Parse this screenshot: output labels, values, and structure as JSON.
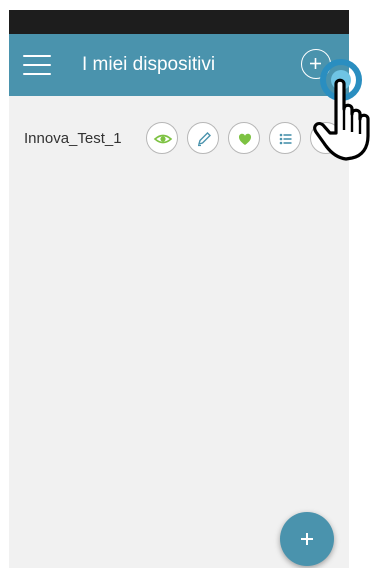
{
  "app_bar": {
    "title": "I miei dispositivi",
    "menu_icon": "hamburger-menu-icon",
    "add_icon": "plus-circle-icon"
  },
  "devices": [
    {
      "name": "Innova_Test_1",
      "actions": [
        {
          "icon": "eye-icon",
          "color": "#7dc242"
        },
        {
          "icon": "pencil-icon",
          "color": "#4a93ad"
        },
        {
          "icon": "heart-icon",
          "color": "#7dc242"
        },
        {
          "icon": "list-icon",
          "color": "#4a93ad"
        },
        {
          "icon": "trash-icon",
          "color": "#8a8a8a"
        }
      ]
    }
  ],
  "fab": {
    "icon": "plus-icon"
  },
  "overlay": {
    "icon": "pointing-hand-icon"
  },
  "colors": {
    "primary": "#4a93ad",
    "accent_green": "#7dc242",
    "status_bar": "#1d1d1d",
    "background": "#f1f1f1"
  }
}
